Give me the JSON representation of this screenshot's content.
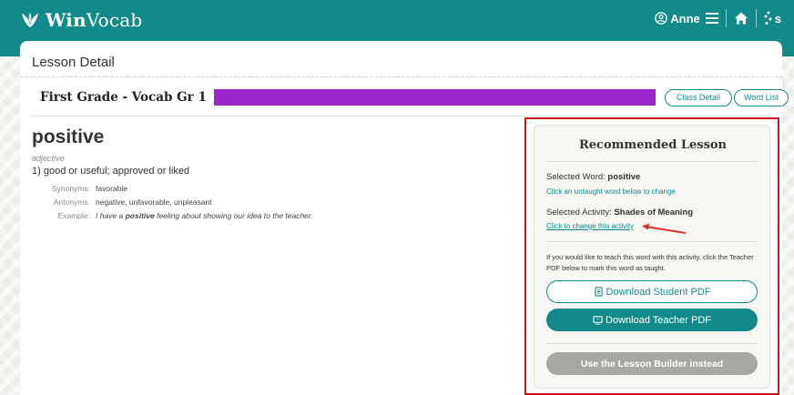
{
  "header": {
    "brand_bold": "Win",
    "brand_rest": "Vocab",
    "user_name": "Anne",
    "secondary_logo_text": "s"
  },
  "page": {
    "title": "Lesson Detail"
  },
  "lesson": {
    "title": "First Grade - Vocab Gr 1",
    "class_detail_label": "Class Detail",
    "word_list_label": "Word List",
    "accent_color": "#9b26c9"
  },
  "word": {
    "term": "positive",
    "part_of_speech": "adjective",
    "definition": "1) good or useful; approved or liked",
    "synonyms_label": "Synonyms:",
    "synonyms": "favorable",
    "antonyms_label": "Antonyms:",
    "antonyms": "negative, unfavorable, unpleasant",
    "example_label": "Example:",
    "example_before": "I have a ",
    "example_bold": "positive",
    "example_after": " feeling about showing our idea to the teacher."
  },
  "recommended": {
    "title": "Recommended Lesson",
    "selected_word_label": "Selected Word: ",
    "selected_word": "positive",
    "change_word_link": "Click an untaught word below to change",
    "selected_activity_label": "Selected Activity: ",
    "selected_activity": "Shades of Meaning",
    "change_activity_link": "Click to change this activity",
    "note": "If you would like to teach this word with this activity, click the Teacher PDF below to mark this word as taught.",
    "download_student": "Download Student PDF",
    "download_teacher": "Download Teacher PDF",
    "lesson_builder": "Use the Lesson Builder instead"
  },
  "colors": {
    "teal": "#138a8a",
    "highlight_red": "#c8161d"
  }
}
